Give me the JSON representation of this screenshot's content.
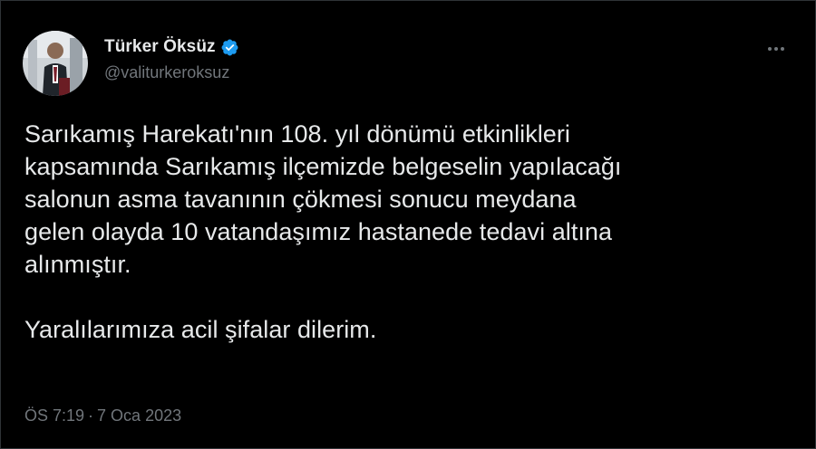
{
  "author": {
    "display_name": "Türker Öksüz",
    "handle": "@valiturkeroksuz",
    "verified": true,
    "verified_color": "#1d9bf0"
  },
  "tweet": {
    "text": "Sarıkamış Harekatı'nın 108. yıl dönümü etkinlikleri\nkapsamında Sarıkamış ilçemizde belgeselin yapılacağı\nsalonun asma tavanının çökmesi sonucu meydana\ngelen olayda 10 vatandaşımız hastanede tedavi altına\nalınmıştır.\n\nYaralılarımıza acil şifalar dilerim.",
    "time": "ÖS 7:19",
    "separator": "·",
    "date": "7 Oca 2023"
  },
  "icons": {
    "avatar": "avatar-photo",
    "verified": "verified-badge-icon",
    "more": "more-options-icon"
  },
  "colors": {
    "background": "#000000",
    "text": "#e7e9ea",
    "secondary_text": "#71767b",
    "border": "#2f3336"
  }
}
